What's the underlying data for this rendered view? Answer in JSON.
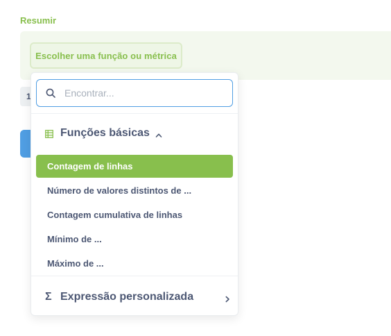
{
  "summarize": {
    "section_label": "Resumir",
    "choose_button_label": "Escolher uma função ou métrica",
    "underlying_chip_text": "1"
  },
  "popover": {
    "search": {
      "placeholder": "Encontrar...",
      "value": "",
      "icon": "search-icon"
    },
    "section": {
      "title": "Funções básicas",
      "icon": "table-icon",
      "expanded": true,
      "items": [
        {
          "label": "Contagem de linhas",
          "selected": true
        },
        {
          "label": "Número de valores distintos de ...",
          "selected": false
        },
        {
          "label": "Contagem cumulativa de linhas",
          "selected": false
        },
        {
          "label": "Mínimo de ...",
          "selected": false
        },
        {
          "label": "Máximo de ...",
          "selected": false
        }
      ]
    },
    "custom_expression": {
      "label": "Expressão personalizada",
      "icon": "sigma-icon"
    }
  },
  "colors": {
    "accent_green": "#88bf4d",
    "focus_blue": "#509ee3",
    "text_dark": "#4c5773"
  }
}
